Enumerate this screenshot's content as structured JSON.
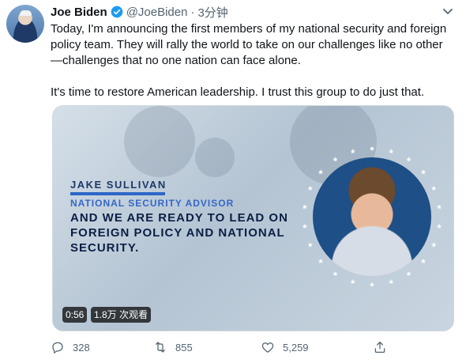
{
  "tweet": {
    "author_name": "Joe Biden",
    "handle": "@JoeBiden",
    "separator": "·",
    "time": "3分钟",
    "text_p1": "Today, I'm announcing the first members of my national security and foreign policy team. They will rally the world to take on our challenges like no other—challenges that no one nation can face alone.",
    "text_p2": "It's time to restore American leadership. I trust this group to do just that."
  },
  "media": {
    "caption_name": "JAKE SULLIVAN",
    "caption_title": "NATIONAL SECURITY ADVISOR",
    "caption_quote": "AND WE ARE READY TO LEAD ON FOREIGN POLICY AND NATIONAL SECURITY.",
    "duration": "0:56",
    "views": "1.8万 次观看"
  },
  "actions": {
    "reply_count": "328",
    "retweet_count": "855",
    "like_count": "5,259"
  },
  "colors": {
    "verified": "#1d9bf0",
    "muted_text": "#536471",
    "caption_navy": "#0b1f45",
    "caption_blue": "#3567c6"
  },
  "icons": {
    "verified": "verified-badge-icon",
    "menu": "chevron-down-icon",
    "reply": "reply-icon",
    "retweet": "retweet-icon",
    "like": "heart-icon",
    "share": "share-icon"
  }
}
